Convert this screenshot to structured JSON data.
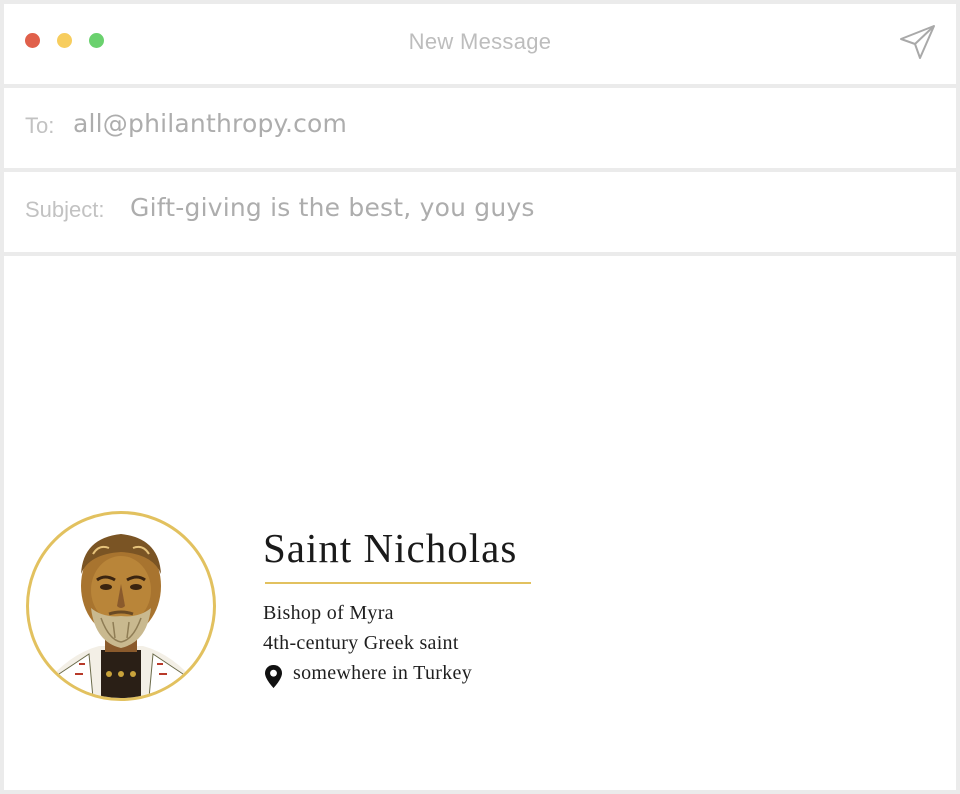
{
  "window": {
    "title": "New Message",
    "controls": [
      {
        "name": "close",
        "color": "#e0604b"
      },
      {
        "name": "minimize",
        "color": "#f7cd5e"
      },
      {
        "name": "maximize",
        "color": "#6ad16e"
      }
    ],
    "send_icon": "paper-plane-icon"
  },
  "compose": {
    "to_label": "To:",
    "to_value": "all@philanthropy.com",
    "subject_label": "Subject:",
    "subject_value": "Gift-giving is the best, you guys"
  },
  "signature": {
    "name": "Saint Nicholas",
    "lines": [
      "Bishop of Myra",
      "4th-century Greek saint"
    ],
    "location": "somewhere in Turkey",
    "location_icon": "map-pin-icon",
    "avatar": "saint-nicholas-icon-portrait",
    "accent_color": "#e2c15f"
  }
}
